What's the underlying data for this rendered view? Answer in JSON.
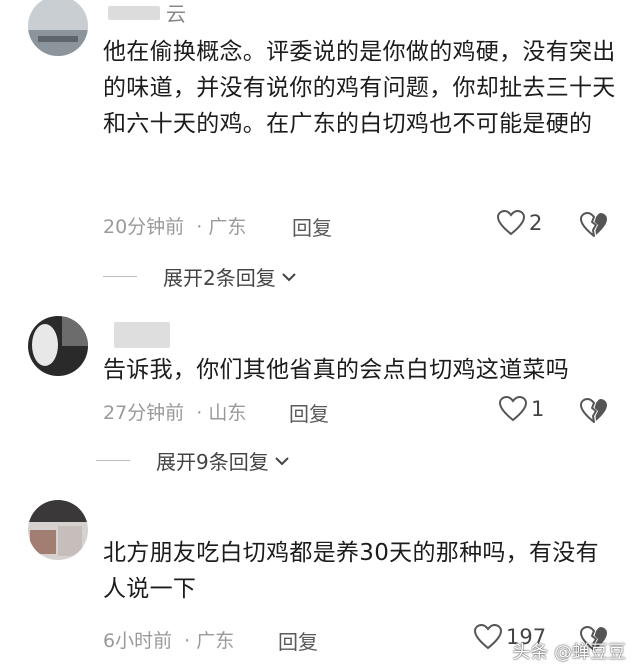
{
  "comments": [
    {
      "username": "云",
      "text": "他在偷换概念。评委说的是你做的鸡硬，没有突出的味道，并没有说你的鸡有问题，你却扯去三十天和六十天的鸡。在广东的白切鸡也不可能是硬的",
      "time": "20分钟前",
      "location": "· 广东",
      "reply_label": "回复",
      "likes": "2",
      "expand_label": "展开2条回复"
    },
    {
      "username": "",
      "text": "告诉我，你们其他省真的会点白切鸡这道菜吗",
      "time": "27分钟前",
      "location": "· 山东",
      "reply_label": "回复",
      "likes": "1",
      "expand_label": "展开9条回复"
    },
    {
      "username": "",
      "text": "北方朋友吃白切鸡都是养30天的那种吗，有没有人说一下",
      "time": "6小时前",
      "location": "· 广东",
      "reply_label": "回复",
      "likes": "197"
    }
  ],
  "watermark": "头条 @蝉豆豆",
  "icons": {
    "like": "heart-outline-icon",
    "dislike": "broken-heart-icon",
    "expand": "chevron-down-icon"
  },
  "colors": {
    "text": "#1c1c1c",
    "meta": "#9a9a9a",
    "icon": "#555555"
  }
}
